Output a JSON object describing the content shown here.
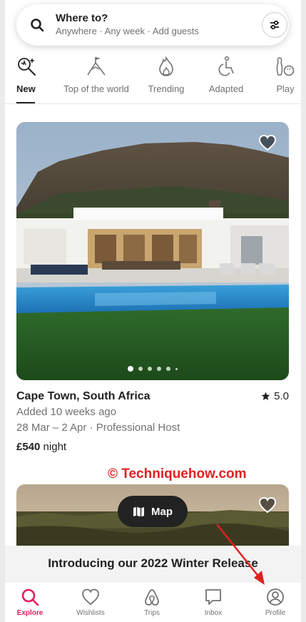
{
  "search": {
    "title": "Where to?",
    "subtitle": "Anywhere · Any week · Add guests"
  },
  "categories": [
    {
      "label": "New",
      "icon": "new-icon",
      "active": true
    },
    {
      "label": "Top of the world",
      "icon": "mountain-flag-icon",
      "active": false
    },
    {
      "label": "Trending",
      "icon": "flame-icon",
      "active": false
    },
    {
      "label": "Adapted",
      "icon": "wheelchair-icon",
      "active": false
    },
    {
      "label": "Play",
      "icon": "bowling-icon",
      "active": false
    }
  ],
  "listing": {
    "title": "Cape Town, South Africa",
    "rating": "5.0",
    "added": "Added 10 weeks ago",
    "dates_host": "28 Mar – 2 Apr · Professional Host",
    "price": "£540",
    "price_unit": "night",
    "photo_count": 6,
    "active_photo": 1
  },
  "watermark": "© Techniquehow.com",
  "map_button": {
    "label": "Map",
    "icon": "map-icon"
  },
  "release_banner": "Introducing our 2022 Winter Release",
  "tabs": [
    {
      "label": "Explore",
      "icon": "search-icon",
      "active": true
    },
    {
      "label": "Wishlists",
      "icon": "heart-icon",
      "active": false
    },
    {
      "label": "Trips",
      "icon": "airbnb-logo-icon",
      "active": false
    },
    {
      "label": "Inbox",
      "icon": "message-icon",
      "active": false
    },
    {
      "label": "Profile",
      "icon": "profile-icon",
      "active": false
    }
  ],
  "colors": {
    "accent": "#e31c5f",
    "annotation": "#e02020",
    "text": "#222222",
    "muted": "#717171"
  }
}
